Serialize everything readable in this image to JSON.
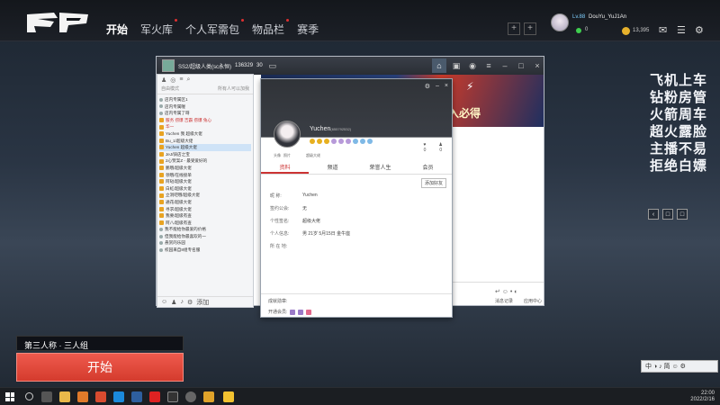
{
  "nav": {
    "items": [
      {
        "label": "开始",
        "active": true,
        "dot": false
      },
      {
        "label": "军火库",
        "active": false,
        "dot": true
      },
      {
        "label": "个人军需包",
        "active": false,
        "dot": true
      },
      {
        "label": "物品栏",
        "active": false,
        "dot": true
      },
      {
        "label": "赛季",
        "active": false,
        "dot": false
      }
    ]
  },
  "user": {
    "level": "Lv.88",
    "name": "DouYu_YuJ1An",
    "online_count": "0",
    "coins": "13,395"
  },
  "danmu": [
    "飞机上车",
    "钻粉房管",
    "火箭周车",
    "超火露脸",
    "主播不易",
    "拒绝白嫖"
  ],
  "chat": {
    "title": "SS2/超级人类(sc永恒)",
    "id": "136329",
    "count": "30",
    "banner_text": "入必得",
    "strip": [
      "我",
      "我",
      "我",
      "陪",
      "图",
      "把",
      "把",
      "把",
      "把"
    ],
    "record_label": "消息记录",
    "app_label": "应用中心"
  },
  "friends": {
    "filter_left": "自由模式",
    "filter_right": "所有人可以加我",
    "rows": [
      "店内专属区1",
      "店内专属喔",
      "店内专属了呀",
      "服务  捞爆  吉霸  捞爆  兔心 ",
      "华一",
      "Yuchen  我 超级大佬",
      "Bu_1/超级大佬",
      "Yuchen   超级大佬",
      "JeJ/骑店之宝",
      "2心赞案Z - 最受爱好的",
      "鹏哦/超级大佬",
      "领哦/在线接单",
      "阿哒/超级大佬",
      "白虹/超级大佬",
      "立洞吧哦/超级大佬",
      "通花/超级大佬",
      "寻求/超级大佬",
      "我要/超级有查",
      "阿八/超级有查",
      "我不能给你最爱的价格",
      "但我能给你最喜欢的一",
      "悬赏的乐园",
      "校园来自8组专名服"
    ],
    "bottom": "添加"
  },
  "profile": {
    "name": "Yuchen",
    "uid": "(655792532)",
    "subtitle": "超级大佬",
    "av_labels": [
      "头像",
      "照片"
    ],
    "stat1": "0",
    "stat2": "0",
    "tabs": [
      "资料",
      "频道",
      "荣誉人生",
      "会员"
    ],
    "add_button": "添加好友",
    "fields": [
      {
        "k": "昵    称:",
        "v": "Yuchen"
      },
      {
        "k": "签约公会:",
        "v": "无"
      },
      {
        "k": "个性签名:",
        "v": "超级大佬"
      },
      {
        "k": "个人信息:",
        "v": "男    21岁    5月15日    金牛座"
      },
      {
        "k": "所 在 地:",
        "v": ""
      }
    ],
    "foot_title": "成就勋章:",
    "foot_label": "开通会员:"
  },
  "start": {
    "mode": "第三人称 · 三人组",
    "button": "开始"
  },
  "ime": {
    "label": "中 ◑ ♪ 简 ☺ ⚙"
  },
  "tray": {
    "time": "22:00",
    "date": "2022/2/16"
  },
  "colors": {
    "accent": "#e0463a",
    "bar_bg": "#14171c"
  }
}
